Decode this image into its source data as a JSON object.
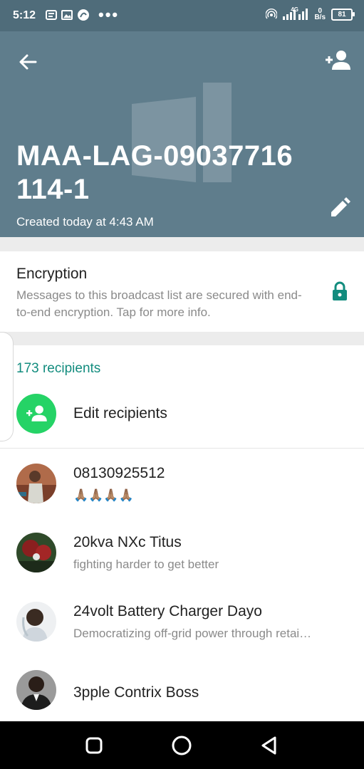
{
  "status_bar": {
    "time": "5:12",
    "dots": "•••",
    "network": "4G",
    "speed_value": "0",
    "speed_unit": "B/s",
    "battery": "81"
  },
  "header": {
    "title": "MAA-LAG-09037716 114-1",
    "subtitle": "Created today at 4:43 AM",
    "color": "#5f7d8c"
  },
  "encryption": {
    "title": "Encryption",
    "description": "Messages to this broadcast list are secured with end-to-end encryption. Tap for more info.",
    "icon": "lock-icon"
  },
  "recipients": {
    "count_label": "173 recipients",
    "edit_label": "Edit recipients",
    "accent": "#25d366"
  },
  "contacts": [
    {
      "name": "08130925512",
      "status": "🙏🏽🙏🏽🙏🏽🙏🏽"
    },
    {
      "name": "20kva NXc Titus",
      "status": "fighting harder to get better"
    },
    {
      "name": "24volt Battery Charger Dayo",
      "status": "Democratizing off-grid power through retai…"
    },
    {
      "name": "3pple Contrix Boss",
      "status": ""
    }
  ]
}
